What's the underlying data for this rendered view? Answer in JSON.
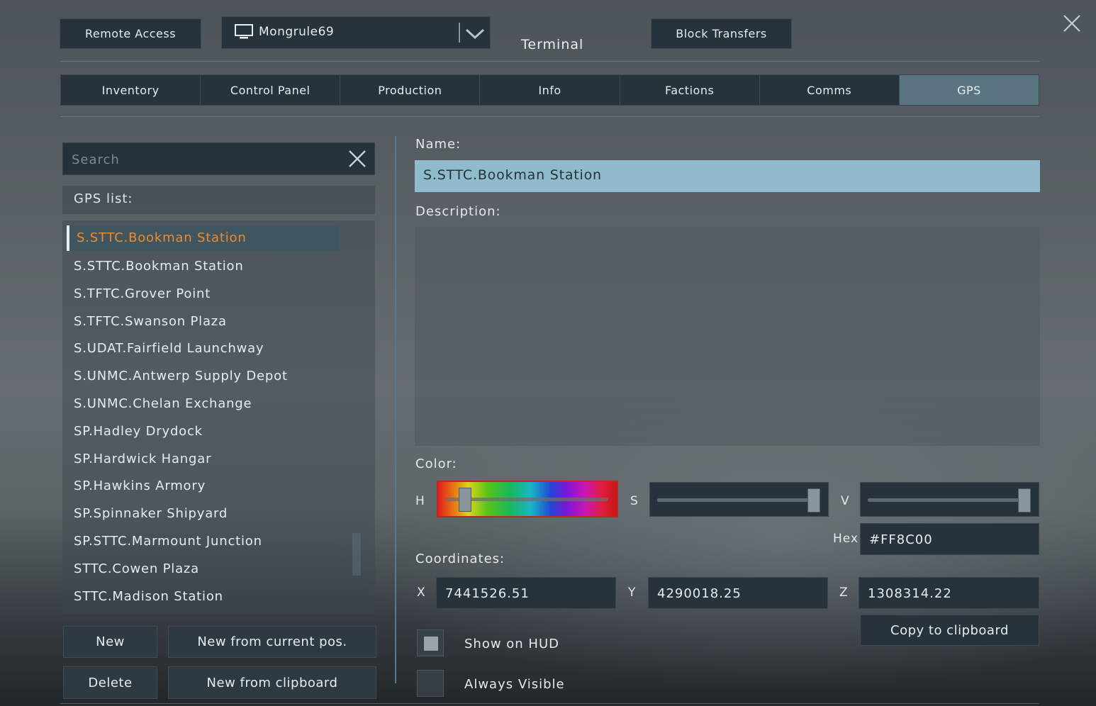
{
  "header": {
    "remote_access": "Remote Access",
    "grid_selector": {
      "value": "Mongrule69"
    },
    "title": "Terminal",
    "block_transfers": "Block Transfers"
  },
  "tabs": [
    "Inventory",
    "Control Panel",
    "Production",
    "Info",
    "Factions",
    "Comms",
    "GPS"
  ],
  "active_tab": "GPS",
  "search": {
    "placeholder": "Search"
  },
  "gps_list": {
    "title": "GPS list:",
    "items": [
      "S.STTC.Bookman Station",
      "S.STTC.Bookman Station",
      "S.TFTC.Grover Point",
      "S.TFTC.Swanson Plaza",
      "S.UDAT.Fairfield Launchway",
      "S.UNMC.Antwerp Supply Depot",
      "S.UNMC.Chelan Exchange",
      "SP.Hadley Drydock",
      "SP.Hardwick Hangar",
      "SP.Hawkins Armory",
      "SP.Spinnaker Shipyard",
      "SP.STTC.Marmount Junction",
      "STTC.Cowen Plaza",
      "STTC.Madison Station"
    ],
    "selected_index": 0
  },
  "buttons": {
    "new": "New",
    "new_from_current": "New from current pos.",
    "delete": "Delete",
    "new_from_clipboard": "New from clipboard",
    "copy_to_clipboard": "Copy to clipboard"
  },
  "detail": {
    "name_label": "Name:",
    "name_value": "S.STTC.Bookman Station",
    "description_label": "Description:",
    "description_value": "",
    "color_label": "Color:",
    "h_label": "H",
    "s_label": "S",
    "v_label": "V",
    "hue_value": 0.09,
    "saturation_value": 1.0,
    "value_value": 1.0,
    "hex_label": "Hex",
    "hex_value": "#FF8C00",
    "coordinates_label": "Coordinates:",
    "x_label": "X",
    "x_value": "7441526.51",
    "y_label": "Y",
    "y_value": "4290018.25",
    "z_label": "Z",
    "z_value": "1308314.22",
    "show_on_hud_label": "Show on  HUD",
    "show_on_hud": true,
    "always_visible_label": "Always Visible",
    "always_visible": false
  },
  "colors": {
    "panel": "#27323b",
    "active_tab": "#5a7480",
    "selected_text": "#f08a2c",
    "name_field": "#8fbbcc"
  }
}
